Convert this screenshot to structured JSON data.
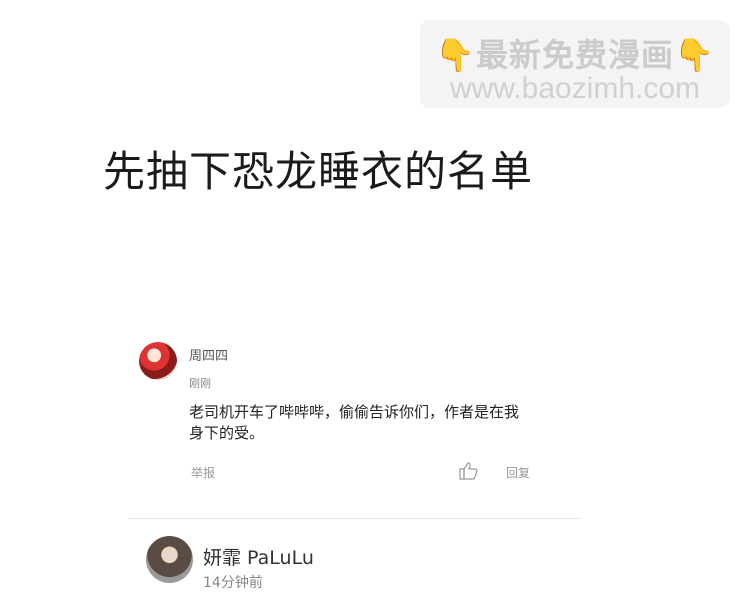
{
  "watermark": {
    "line1_text": "最新免费漫画",
    "hand_left": "👇",
    "hand_right": "👇",
    "line2": "www.baozimh.com"
  },
  "headline": "先抽下恐龙睡衣的名单",
  "comments": [
    {
      "username": "周四四",
      "time": "刚刚",
      "text": "老司机开车了哔哔哔，偷偷告诉你们，作者是在我身下的受。",
      "report_label": "举报",
      "like_icon": "thumbs-up-icon",
      "reply_label": "回复"
    },
    {
      "username": "妍霏 PaLuLu",
      "time": "14分钟前"
    }
  ],
  "colors": {
    "background": "#ffffff",
    "watermark_bg": "#f4f4f4",
    "hand_icon": "#f2b21b"
  }
}
